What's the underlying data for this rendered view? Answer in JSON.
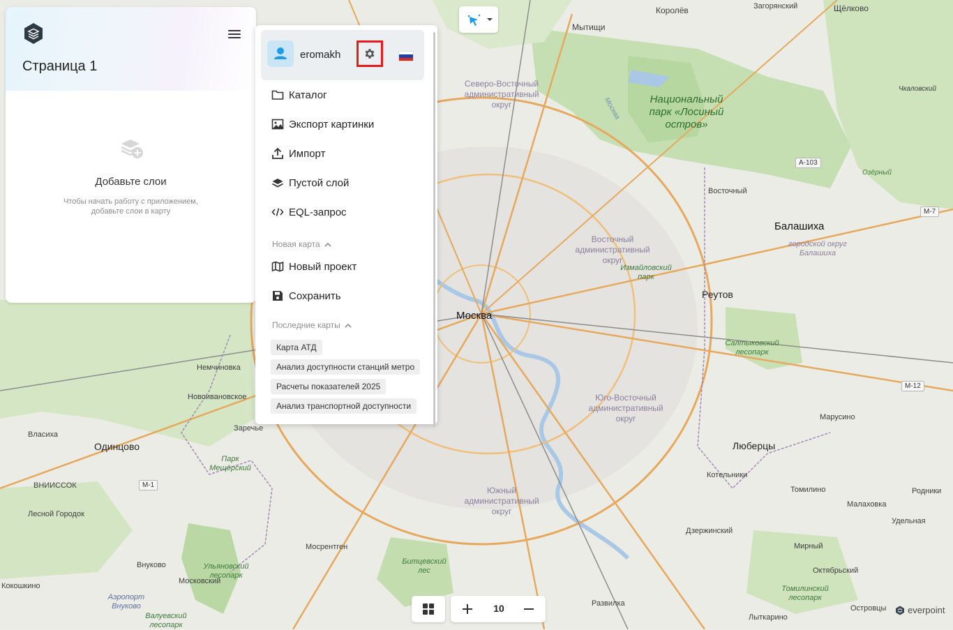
{
  "left_panel": {
    "page_title": "Страница 1",
    "empty_title": "Добавьте слои",
    "empty_subtitle": "Чтобы начать работу с приложением, добавьте слои в карту"
  },
  "menu": {
    "username": "eromakh",
    "items": [
      {
        "label": "Каталог",
        "icon": "folder-icon"
      },
      {
        "label": "Экспорт картинки",
        "icon": "image-icon"
      },
      {
        "label": "Импорт",
        "icon": "upload-icon"
      },
      {
        "label": "Пустой слой",
        "icon": "layers-icon"
      },
      {
        "label": "EQL-запрос",
        "icon": "code-icon"
      }
    ],
    "new_map_header": "Новая карта",
    "new_map_items": [
      {
        "label": "Новый проект",
        "icon": "map-icon"
      },
      {
        "label": "Сохранить",
        "icon": "save-icon"
      }
    ],
    "recent_header": "Последние карты",
    "recent_maps": [
      "Карта АТД",
      "Анализ доступности станций метро",
      "Расчеты показателей 2025",
      "Анализ транспортной доступности"
    ]
  },
  "zoom": {
    "level": "10"
  },
  "attribution": {
    "brand": "everpoint"
  },
  "colors": {
    "accent": "#1e9be6",
    "highlight": "#e51b1b"
  },
  "map_labels": {
    "cities": [
      "Королёв",
      "Мытищи",
      "Щёлково",
      "Загорянский",
      "Москва",
      "Балашиха",
      "Реутов",
      "Люберцы",
      "Одинцово",
      "Котельники",
      "Восточный",
      "Мосрентген",
      "Внуково",
      "Московский",
      "Дзержинский",
      "Томилино",
      "Малаховка",
      "Мирный",
      "Октябрьский",
      "Удельная",
      "Родники",
      "Марусино",
      "Лыткарино",
      "Островцы",
      "Развилка",
      "Немчиновка",
      "Новоивановское",
      "Заречье",
      "Власиха",
      "ВНИИССОК",
      "Лесной Городок",
      "Кокошкино",
      "Чкаловский",
      "Озёрный"
    ],
    "districts": [
      "Северо-Восточный административный округ",
      "Восточный административный округ",
      "Юго-Восточный административный округ",
      "Южный административный округ"
    ],
    "parks": [
      "Национальный парк «Лосиный остров»",
      "Измайловский парк",
      "Салтыковский лесопарк",
      "Парк Мещёрский",
      "Ульяновский лесопарк",
      "Битцевский лес",
      "Томилинский лесопарк",
      "Валуевский лесопарк",
      "городской округ Балашиха",
      "Аэропорт Внуково"
    ],
    "shields": [
      "А-103",
      "М-7",
      "М-12",
      "М-1"
    ],
    "river": "Москва"
  }
}
